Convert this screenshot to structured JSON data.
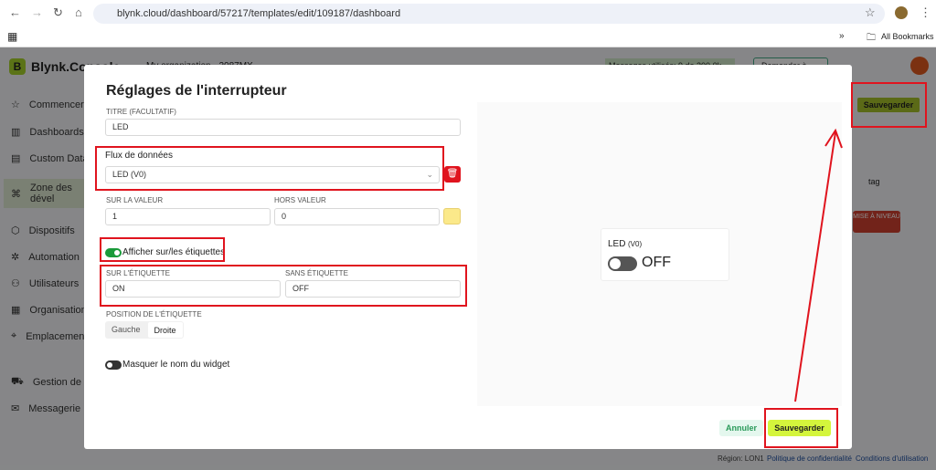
{
  "browser": {
    "url": "blynk.cloud/dashboard/57217/templates/edit/109187/dashboard",
    "bookmarks_label": "All Bookmarks"
  },
  "app": {
    "logo_letter": "B",
    "brand": "Blynk.Console",
    "org": "My organization - 2087MX",
    "messages": "Messages utilisés: 9 de 200.0k",
    "ask_ai": "Demander à l'IA",
    "save_top": "Sauvegarder",
    "tag": "tag",
    "upgrade": "MISE À NIVEAU",
    "sidebar": [
      {
        "label": "Commencer",
        "icon": "star-icon"
      },
      {
        "label": "Dashboards",
        "icon": "chart-icon"
      },
      {
        "label": "Custom Data",
        "icon": "database-icon"
      },
      {
        "label": "Zone des dével",
        "icon": "developer-icon",
        "active": true
      },
      {
        "label": "Dispositifs",
        "icon": "devices-icon"
      },
      {
        "label": "Automation",
        "icon": "automation-icon"
      },
      {
        "label": "Utilisateurs",
        "icon": "users-icon"
      },
      {
        "label": "Organisations",
        "icon": "org-icon"
      },
      {
        "label": "Emplacements",
        "icon": "location-icon"
      },
      {
        "label": "Gestion de Flott",
        "icon": "truck-icon"
      },
      {
        "label": "Messagerie In-A",
        "icon": "message-icon"
      }
    ],
    "footer": {
      "region": "Région: LON1",
      "privacy": "Politique de confidentialité",
      "terms": "Conditions d'utilisation"
    }
  },
  "modal": {
    "title": "Réglages de l'interrupteur",
    "title_label": "TITRE (FACULTATIF)",
    "title_value": "LED",
    "datastream_label": "Flux de données",
    "datastream_value": "LED (V0)",
    "on_value_label": "SUR LA VALEUR",
    "on_value": "1",
    "off_value_label": "HORS VALEUR",
    "off_value": "0",
    "color": "#fbe98a",
    "show_labels": "Afficher sur/les étiquettes",
    "show_labels_on": true,
    "on_label_label": "SUR L'ÉTIQUETTE",
    "on_label": "ON",
    "off_label_label": "SANS ÉTIQUETTE",
    "off_label": "OFF",
    "position_label": "POSITION DE L'ÉTIQUETTE",
    "position_options": [
      "Gauche",
      "Droite"
    ],
    "position_selected": "Droite",
    "hide_name": "Masquer le nom du widget",
    "hide_name_on": false,
    "cancel": "Annuler",
    "save": "Sauvegarder",
    "preview": {
      "name": "LED",
      "pin": "(V0)",
      "state": "OFF"
    }
  },
  "colors": {
    "accent": "#d4f53c",
    "annotation": "#e0141e",
    "toggle_on": "#1a9a3a"
  }
}
